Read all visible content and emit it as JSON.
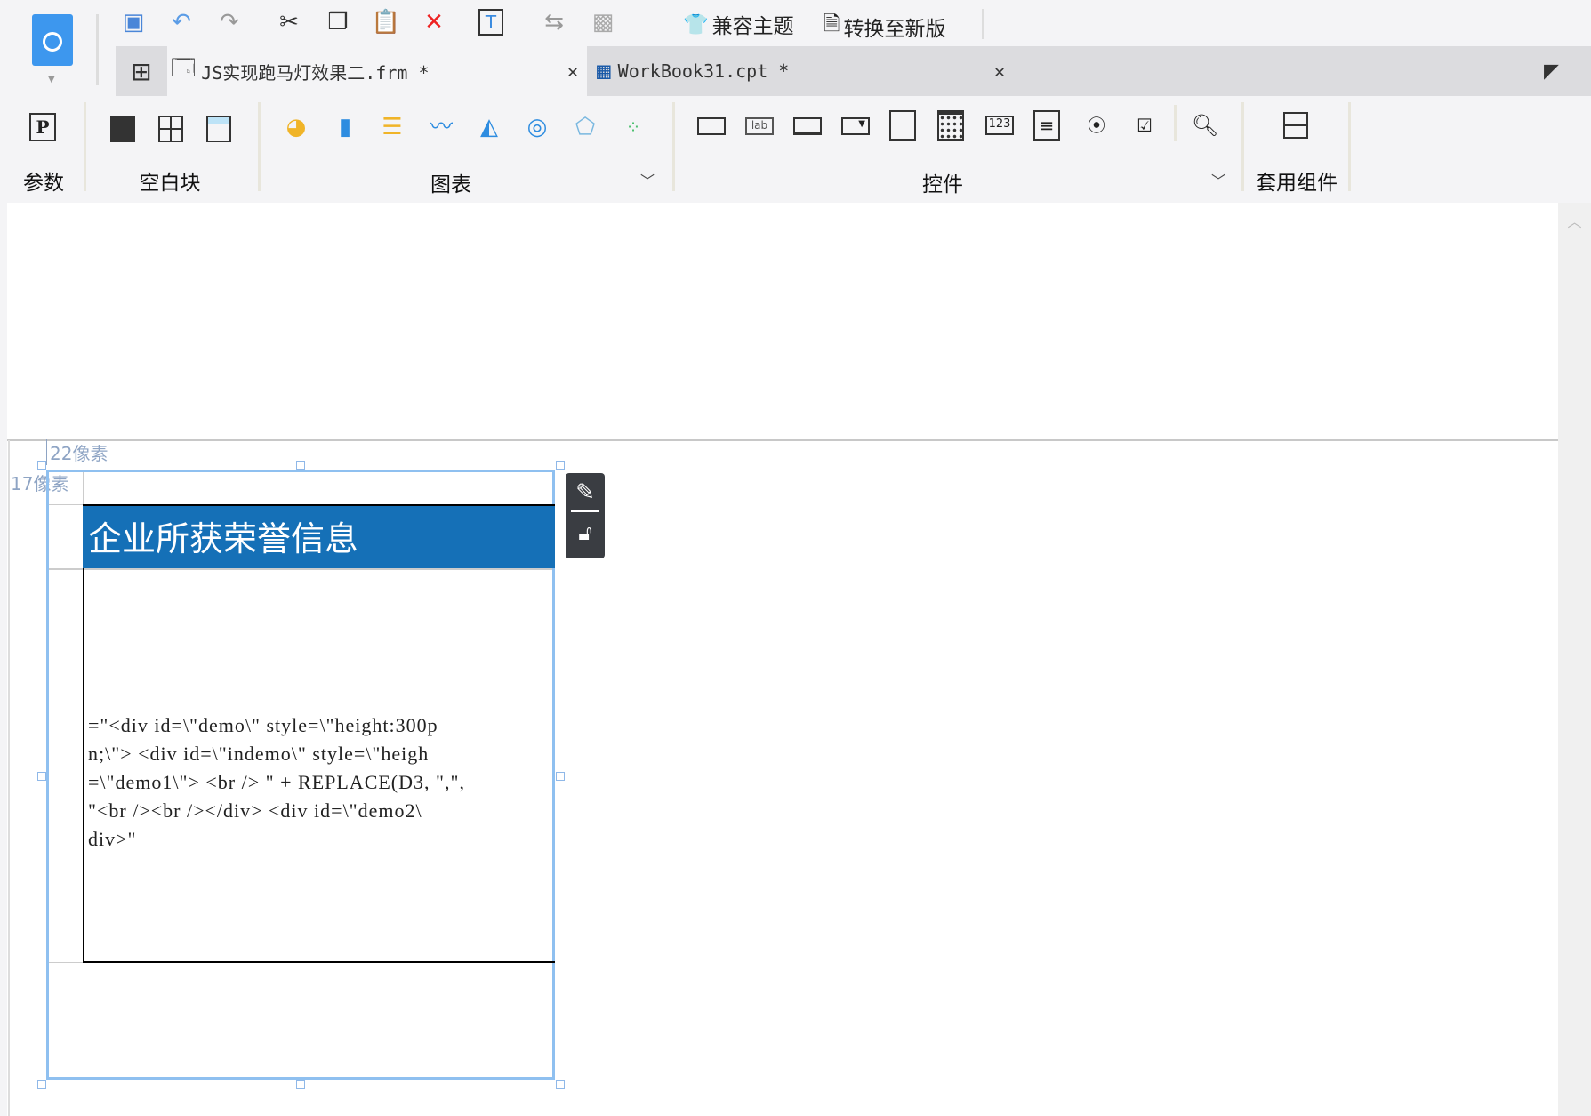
{
  "toolbar": {
    "theme_label": "兼容主题",
    "convert_label": "转换至新版"
  },
  "tabs": [
    {
      "label": "JS实现跑马灯效果二.frm *",
      "close": "✕"
    },
    {
      "label": "WorkBook31.cpt *",
      "close": "✕"
    }
  ],
  "ribbon": {
    "param_label": "参数",
    "blank_label": "空白块",
    "chart_label": "图表",
    "widget_label": "控件",
    "component_label": "套用组件",
    "lab_icon_text": "lab",
    "num_icon_text": "123",
    "param_icon_text": "P"
  },
  "canvas": {
    "top_margin": "22像素",
    "left_margin": "17像素",
    "header_title": "企业所获荣誉信息",
    "code_lines": [
      "=\"<div id=\\\"demo\\\" style=\\\"height:300p",
      "n;\\\"> <div id=\\\"indemo\\\" style=\\\"heigh",
      "=\\\"demo1\\\"> <br /> \" + REPLACE(D3, \",\",",
      "\"<br /><br /></div> <div id=\\\"demo2\\",
      "div>\""
    ]
  },
  "colors": {
    "header_bg": "#1570b7",
    "selection": "#8fc0f0",
    "panel": "#3a3d42"
  }
}
